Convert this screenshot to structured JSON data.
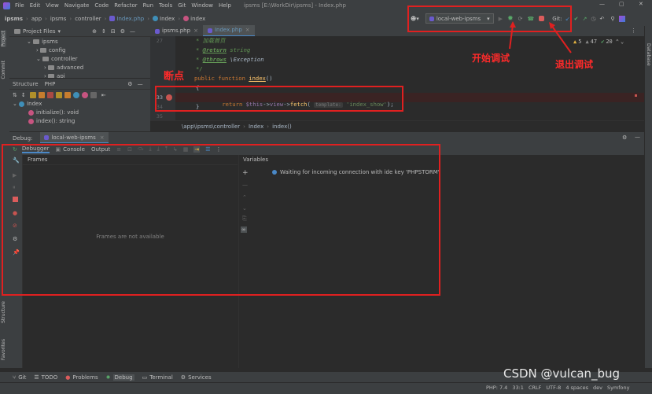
{
  "window": {
    "title": "ipsms [E:\\WorkDir\\ipsms] - Index.php",
    "menu": [
      "File",
      "Edit",
      "View",
      "Navigate",
      "Code",
      "Refactor",
      "Run",
      "Tools",
      "Git",
      "Window",
      "Help"
    ]
  },
  "breadcrumb": [
    "ipsms",
    "app",
    "ipsms",
    "controller",
    "Index.php",
    "Index",
    "index"
  ],
  "toolbar": {
    "run_config": "local-web-ipsms",
    "git_label": "Git:"
  },
  "project_panel": {
    "title": "Project Files",
    "tree": [
      "ipsms",
      "config",
      "controller",
      "advanced",
      "api"
    ]
  },
  "structure_panel": {
    "tabs": [
      "Structure",
      "PHP"
    ],
    "items": [
      "Index",
      "initialize(): void",
      "index(): string"
    ]
  },
  "editor": {
    "tabs": [
      "ipsms.php",
      "Index.php"
    ],
    "inspections": {
      "warnings": "5",
      "weak": "47",
      "typos": "20"
    },
    "lines": [
      {
        "num": "27",
        "text": "* 加载首页"
      },
      {
        "num": "",
        "text": "* @return string"
      },
      {
        "num": "",
        "text": "* @throws \\Exception"
      },
      {
        "num": "",
        "text": "*/"
      },
      {
        "num": "",
        "text": "public function index()"
      },
      {
        "num": "",
        "text": "{"
      },
      {
        "num": "33",
        "text": "return $this->view->fetch("
      },
      {
        "num": "34",
        "text": "}"
      },
      {
        "num": "35",
        "text": ""
      }
    ],
    "code_tokens": {
      "doc_star": "*",
      "return_tag": "@return",
      "return_type": "string",
      "throws_tag": "@throws",
      "throws_type": "\\Exception",
      "public": "public function",
      "fn_name": "index",
      "paren": "()",
      "return_kw": "return",
      "this": "$this",
      "arrow1": "->",
      "view": "view",
      "arrow2": "->",
      "fetch": "fetch",
      "open": "(",
      "hint": "template:",
      "string_arg": "'index_show'",
      "close": ");"
    },
    "status_path": [
      "\\app\\ipsms\\controller",
      "Index",
      "index()"
    ]
  },
  "debug": {
    "label": "Debug:",
    "session_tab": "local-web-ipsms",
    "tabs": [
      "Debugger",
      "Console",
      "Output"
    ],
    "frames_title": "Frames",
    "frames_empty": "Frames are not available",
    "variables_title": "Variables",
    "waiting_message": "Waiting for incoming connection with ide key 'PHPSTORM'"
  },
  "bottom_tools": [
    "Git",
    "TODO",
    "Problems",
    "Debug",
    "Terminal",
    "Services"
  ],
  "statusbar": [
    "PHP: 7.4",
    "33:1",
    "CRLF",
    "UTF-8",
    "4 spaces",
    "dev",
    "Symfony"
  ],
  "side_tabs": {
    "left": [
      "Project",
      "Commit",
      "Structure",
      "Favorites"
    ],
    "right": [
      "Database"
    ]
  },
  "annotations": {
    "breakpoint": "断点",
    "start_debug": "开始调试",
    "stop_debug": "退出调试"
  },
  "watermark": "CSDN @vulcan_bug",
  "colors": {
    "annotation": "#e02020",
    "breakpoint": "#c75450",
    "accent": "#4a88c7"
  }
}
